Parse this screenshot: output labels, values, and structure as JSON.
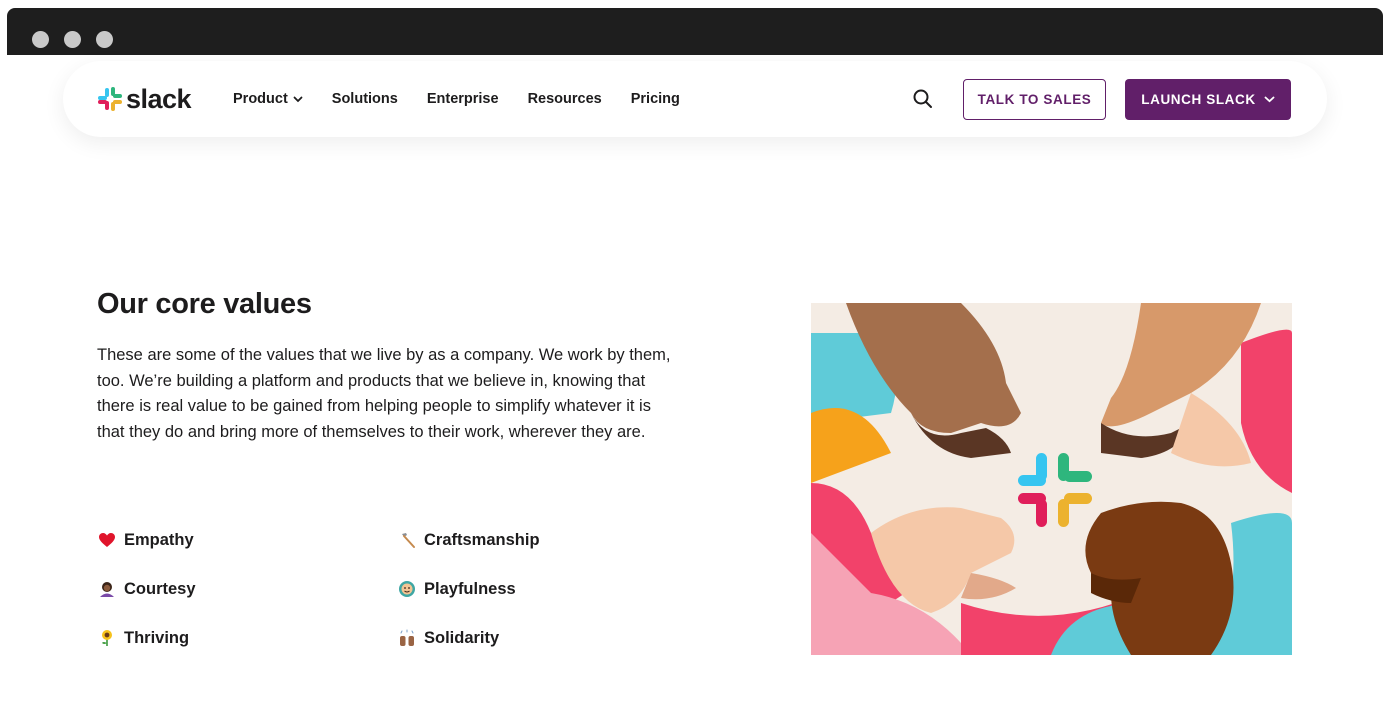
{
  "brand": {
    "name": "slack"
  },
  "nav": {
    "links": [
      {
        "label": "Product",
        "has_dropdown": true
      },
      {
        "label": "Solutions"
      },
      {
        "label": "Enterprise"
      },
      {
        "label": "Resources"
      },
      {
        "label": "Pricing"
      }
    ],
    "talk_to_sales": "TALK TO SALES",
    "launch_slack": "LAUNCH SLACK"
  },
  "colors": {
    "primary_purple": "#611f69",
    "text": "#1d1c1d"
  },
  "section": {
    "title": "Our core values",
    "description": "These are some of the values that we live by as a company. We work by them, too. We’re building a platform and products that we believe in, knowing that there is real value to be gained from helping people to simplify whatever it is that they do and bring more of themselves to their work, wherever they are.",
    "values": [
      {
        "label": "Empathy",
        "icon": "heart-icon"
      },
      {
        "label": "Craftsmanship",
        "icon": "hammer-icon"
      },
      {
        "label": "Courtesy",
        "icon": "person-bowing-icon"
      },
      {
        "label": "Playfulness",
        "icon": "face-icon"
      },
      {
        "label": "Thriving",
        "icon": "sunflower-icon"
      },
      {
        "label": "Solidarity",
        "icon": "raised-hands-icon"
      }
    ]
  }
}
